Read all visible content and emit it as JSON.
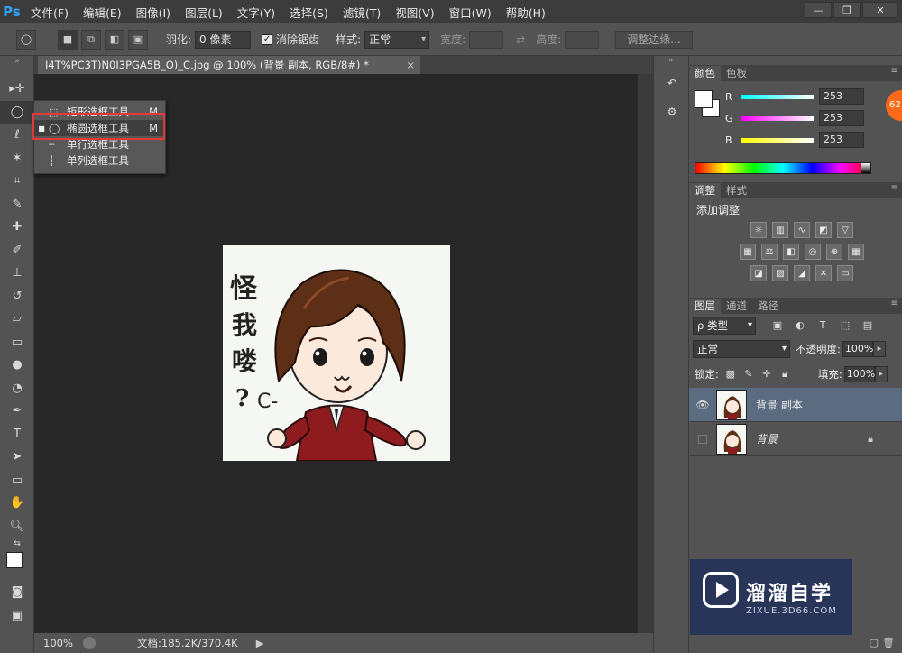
{
  "app": {
    "logo": "Ps"
  },
  "menu": [
    "文件(F)",
    "编辑(E)",
    "图像(I)",
    "图层(L)",
    "文字(Y)",
    "选择(S)",
    "滤镜(T)",
    "视图(V)",
    "窗口(W)",
    "帮助(H)"
  ],
  "window_buttons": {
    "minimize": "—",
    "restore": "❐",
    "close": "✕"
  },
  "options": {
    "feather_label": "羽化:",
    "feather_value": "0 像素",
    "antialias_label": "消除锯齿",
    "antialias_checked": true,
    "style_label": "样式:",
    "style_value": "正常",
    "width_label": "宽度:",
    "height_label": "高度:",
    "refine_button": "调整边缘..."
  },
  "document": {
    "tab_title": "I4T%PC3T)N0I3PGA5B_O)_C.jpg @ 100% (背景 副本, RGB/8#) *",
    "tab_close": "×"
  },
  "canvas_art": {
    "calligraphy": "怪\n我\n喽\n?",
    "emote": "C-"
  },
  "status": {
    "zoom": "100%",
    "doc_info": "文档:185.2K/370.4K",
    "arrow": "▶"
  },
  "tool_flyout": {
    "items": [
      {
        "icon": "rect-marquee-icon",
        "label": "矩形选框工具",
        "key": "M",
        "active": false
      },
      {
        "icon": "ellipse-marquee-icon",
        "label": "椭圆选框工具",
        "key": "M",
        "active": true
      },
      {
        "icon": "row-marquee-icon",
        "label": "单行选框工具",
        "key": "",
        "active": false
      },
      {
        "icon": "col-marquee-icon",
        "label": "单列选框工具",
        "key": "",
        "active": false
      }
    ],
    "highlight_color": "#e03a3a"
  },
  "tools": [
    "move-icon",
    "ellipse-marquee-icon",
    "lasso-icon",
    "magic-wand-icon",
    "crop-icon",
    "eyedropper-icon",
    "spot-heal-icon",
    "brush-icon",
    "stamp-icon",
    "history-brush-icon",
    "eraser-icon",
    "gradient-icon",
    "blur-icon",
    "dodge-icon",
    "pen-icon",
    "type-icon",
    "path-select-icon",
    "rectangle-icon",
    "hand-icon",
    "zoom-icon"
  ],
  "color_panel": {
    "tabs": [
      "颜色",
      "色板"
    ],
    "fg_color": "#fdfdfd",
    "bg_color": "#fdfdfd",
    "channels": [
      {
        "label": "R",
        "value": "253",
        "gradient": "#00ffff"
      },
      {
        "label": "G",
        "value": "253",
        "gradient": "#ff00ff"
      },
      {
        "label": "B",
        "value": "253",
        "gradient": "#ffff00"
      }
    ],
    "badge": "62"
  },
  "adjust_panel": {
    "tabs": [
      "调整",
      "样式"
    ],
    "title": "添加调整"
  },
  "layers_panel": {
    "tabs": [
      "图层",
      "通道",
      "路径"
    ],
    "kind_filter": "ρ 类型",
    "blend_mode": "正常",
    "opacity_label": "不透明度:",
    "opacity_value": "100%",
    "lock_label": "锁定:",
    "fill_label": "填充:",
    "fill_value": "100%",
    "layers": [
      {
        "name": "背景 副本",
        "visible": true,
        "selected": true,
        "locked": false
      },
      {
        "name": "背景",
        "visible": false,
        "selected": false,
        "locked": true
      }
    ]
  },
  "watermark": {
    "title": "溜溜自学",
    "url": "ZIXUE.3D66.COM"
  }
}
